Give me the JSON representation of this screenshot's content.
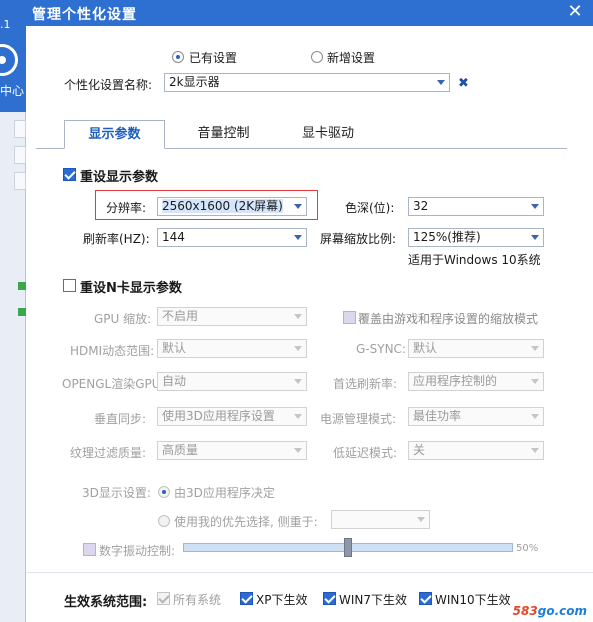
{
  "background_app": {
    "version_fragment": ".1",
    "center_fragment": "中心"
  },
  "dialog": {
    "title": "管理个性化设置",
    "close_glyph": "✕"
  },
  "profile": {
    "existing_label": "已有设置",
    "new_label": "新增设置",
    "name_label": "个性化设置名称:",
    "name_value": "2k显示器",
    "delete_glyph": "✖"
  },
  "tabs": [
    {
      "label": "显示参数",
      "active": true
    },
    {
      "label": "音量控制",
      "active": false
    },
    {
      "label": "显卡驱动",
      "active": false
    }
  ],
  "display": {
    "reset_label": "重设显示参数",
    "resolution_label": "分辨率:",
    "resolution_value": "2560x1600 (2K屏幕)",
    "color_depth_label": "色深(位):",
    "color_depth_value": "32",
    "refresh_label": "刷新率(HZ):",
    "refresh_value": "144",
    "scale_label": "屏幕缩放比例:",
    "scale_value": "125%(推荐)",
    "scale_note": "适用于Windows 10系统"
  },
  "nv": {
    "reset_label": "重设N卡显示参数",
    "gpu_scale_label": "GPU 缩放:",
    "gpu_scale_value": "不启用",
    "override_label": "覆盖由游戏和程序设置的缩放模式",
    "hdmi_label": "HDMI动态范围:",
    "hdmi_value": "默认",
    "gsync_label": "G-SYNC:",
    "gsync_value": "默认",
    "opengl_label": "OPENGL渲染GPU:",
    "opengl_value": "自动",
    "pref_refresh_label": "首选刷新率:",
    "pref_refresh_value": "应用程序控制的",
    "vsync_label": "垂直同步:",
    "vsync_value": "使用3D应用程序设置",
    "power_label": "电源管理模式:",
    "power_value": "最佳功率",
    "texture_label": "纹理过滤质量:",
    "texture_value": "高质量",
    "latency_label": "低延迟模式:",
    "latency_value": "关",
    "display3d_label": "3D显示设置:",
    "display3d_opt1": "由3D应用程序决定",
    "display3d_opt2": "使用我的优先选择, 侧重于:",
    "vibrance_label": "数字振动控制:",
    "vibrance_percent": 50,
    "vibrance_text": "50%"
  },
  "scope": {
    "label": "生效系统范围:",
    "items": [
      {
        "label": "所有系统",
        "checked": true,
        "disabled": true
      },
      {
        "label": "XP下生效",
        "checked": true,
        "disabled": false
      },
      {
        "label": "WIN7下生效",
        "checked": true,
        "disabled": false
      },
      {
        "label": "WIN10下生效",
        "checked": true,
        "disabled": false
      }
    ]
  },
  "watermark": {
    "part1": "583",
    "part2": "go.com"
  },
  "colors": {
    "title_bar": "#2e6fd2",
    "accent": "#2b6bd4",
    "highlight": "#e23a3a"
  }
}
